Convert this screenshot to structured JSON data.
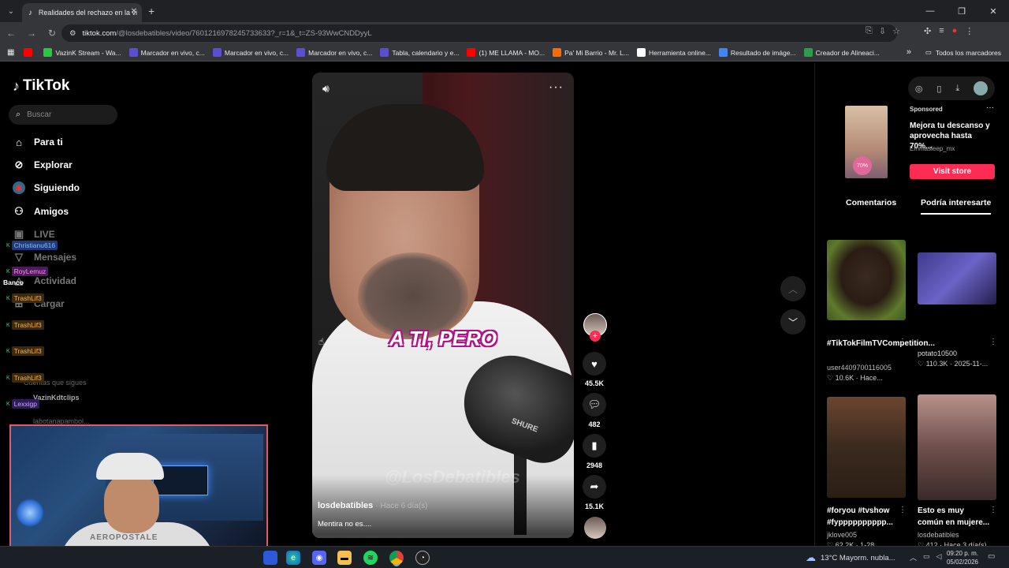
{
  "browser": {
    "tab_title": "Realidades del rechazo en la vi",
    "tab_close": "✕",
    "new_tab": "+",
    "url_host": "tiktok.com",
    "url_path": "/@losdebatibles/video/7601216978245733633?_r=1&_t=ZS-93WwCNDDyyL",
    "bookmarks": [
      {
        "label": "",
        "color": "#ff0000"
      },
      {
        "label": "VazinK Stream - Wa...",
        "color": "#27c93f"
      },
      {
        "label": "Marcador en vivo, c...",
        "color": "#5b4fd1"
      },
      {
        "label": "Marcador en vivo, c...",
        "color": "#5b4fd1"
      },
      {
        "label": "Marcador en vivo, c...",
        "color": "#5b4fd1"
      },
      {
        "label": "Tabla, calendario y e...",
        "color": "#5b4fd1"
      },
      {
        "label": "(1) ME LLAMA - MO...",
        "color": "#ff0000"
      },
      {
        "label": "Pa' Mi Barrio - Mr. L...",
        "color": "#ff6a00"
      },
      {
        "label": "Herramienta online...",
        "color": "#ffffff"
      },
      {
        "label": "Resultado de imáge...",
        "color": "#4285f4"
      },
      {
        "label": "Creador de Alineaci...",
        "color": "#2e9c4f"
      }
    ],
    "bookmarks_more": "»",
    "all_bookmarks": "Todos los marcadores"
  },
  "sidebar": {
    "logo": "TikTok",
    "search_placeholder": "Buscar",
    "items": [
      {
        "label": "Para ti",
        "icon": "home-icon"
      },
      {
        "label": "Explorar",
        "icon": "compass-icon"
      },
      {
        "label": "Siguiendo",
        "icon": "following-icon"
      },
      {
        "label": "Amigos",
        "icon": "friends-icon"
      },
      {
        "label": "LIVE",
        "icon": "live-icon"
      },
      {
        "label": "Mensajes",
        "icon": "messages-icon"
      },
      {
        "label": "Actividad",
        "icon": "activity-icon"
      },
      {
        "label": "Cargar",
        "icon": "upload-icon"
      }
    ],
    "section_label": "Cuentas que sigues",
    "followed": [
      "VazinKdtclips",
      "labotanapambol..."
    ]
  },
  "chat_overlay": {
    "entries": [
      {
        "user": "Christianu616",
        "bg": "#1e3a78",
        "color": "#8fb8ff"
      },
      {
        "user": "RoyLemuz",
        "bg": "#4a1c5a",
        "color": "#ff8cf0"
      },
      {
        "user": "TrashLif3",
        "bg": "#3d2a0d",
        "color": "#ffb347"
      },
      {
        "user": "TrashLif3",
        "bg": "#3d2a0d",
        "color": "#ffb347"
      },
      {
        "user": "TrashLif3",
        "bg": "#3d2a0d",
        "color": "#ffb347"
      },
      {
        "user": "TrashLif3",
        "bg": "#3d2a0d",
        "color": "#ffb347"
      },
      {
        "user": "Lexxigp",
        "bg": "#2e1c5a",
        "color": "#c7a6ff"
      }
    ],
    "banco": "Banco"
  },
  "webcam": {
    "shirt_text": "AEROPOSTALE"
  },
  "video": {
    "caption": "A TI, PERO",
    "watermark": "@LosDebatibles",
    "mic_brand": "SHURE",
    "author": "losdebatibles",
    "age": "· Hace 6 día(s)",
    "description": "Mentira no es....",
    "likes": "45.5K",
    "comments": "482",
    "saves": "2948",
    "shares": "15.1K"
  },
  "ad": {
    "sponsored": "Sponsored",
    "title": "Mejora tu descanso y aprovecha hasta 70%...",
    "source": "Emmasleep_mx",
    "button": "Visit store",
    "badge": "70%"
  },
  "right_tabs": {
    "comments": "Comentarios",
    "suggested": "Podría interesarte"
  },
  "suggestions": [
    {
      "title": "#TikTokFilmTVCompetition...",
      "user": "user4409700116005",
      "likes": "♡ 10.6K",
      "time": "· Hace..."
    },
    {
      "title": "",
      "user": "potato10500",
      "likes": "♡ 110.3K",
      "time": "· 2025-11-..."
    },
    {
      "title": "#foryou #tvshow #fypppppppppp...",
      "user": "jklove005",
      "likes": "♡ 62.2K",
      "time": "· 1-28"
    },
    {
      "title": "Esto es muy común en mujere...",
      "user": "losdebatibles",
      "likes": "♡ 412",
      "time": "· Hace 3 día(s)"
    }
  ],
  "taskbar": {
    "weather": "13°C  Mayorm. nubla...",
    "time": "09:20 p. m.",
    "date": "05/02/2026"
  }
}
